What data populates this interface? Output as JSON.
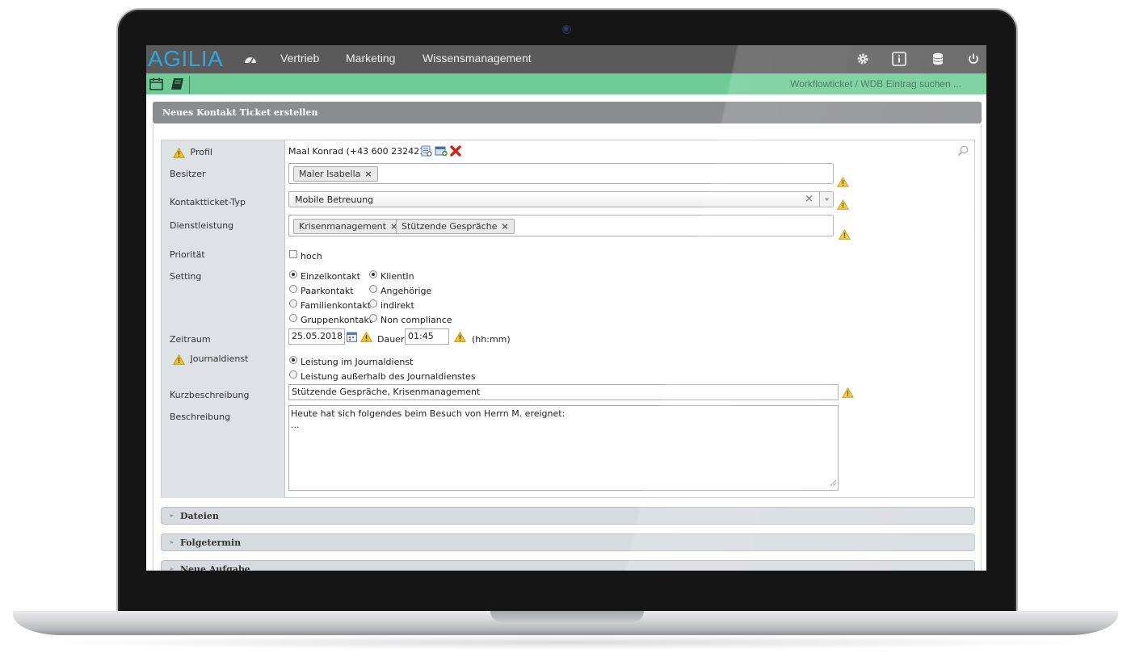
{
  "app": {
    "logo": "AGILIA"
  },
  "nav": {
    "menu": [
      "Vertrieb",
      "Marketing",
      "Wissensmanagement"
    ],
    "icons": [
      "dashboard-icon",
      "gear-icon",
      "info-icon",
      "database-icon",
      "power-icon"
    ]
  },
  "subbar": {
    "search_link": "Workflowticket / WDB Eintrag suchen ..."
  },
  "panel": {
    "title": "Neues Kontakt Ticket erstellen"
  },
  "form": {
    "labels": {
      "profil": "Profil",
      "besitzer": "Besitzer",
      "typ": "Kontaktticket-Typ",
      "dienstleistung": "Dienstleistung",
      "prioritaet": "Priorität",
      "setting": "Setting",
      "zeitraum": "Zeitraum",
      "journaldienst": "Journaldienst",
      "kurzbeschreibung": "Kurzbeschreibung",
      "beschreibung": "Beschreibung"
    },
    "profil_value": "Maal Konrad (+43 600 232421)",
    "besitzer_tags": [
      "Maler Isabella"
    ],
    "typ_value": "Mobile Betreuung",
    "dienstleistung_tags": [
      "Krisenmanagement",
      "Stützende Gespräche"
    ],
    "prioritaet": {
      "label": "hoch",
      "checked": false
    },
    "setting": {
      "left": [
        {
          "label": "Einzelkontakt",
          "selected": true
        },
        {
          "label": "Paarkontakt",
          "selected": false
        },
        {
          "label": "Familienkontakt",
          "selected": false
        },
        {
          "label": "Gruppenkontakt",
          "selected": false
        }
      ],
      "right": [
        {
          "label": "KlientIn",
          "selected": true
        },
        {
          "label": "Angehörige",
          "selected": false
        },
        {
          "label": "indirekt",
          "selected": false
        },
        {
          "label": "Non compliance",
          "selected": false
        }
      ]
    },
    "zeitraum": {
      "date": "25.05.2018",
      "dauer_label": "Dauer",
      "dauer": "01:45",
      "unit": "(hh:mm)"
    },
    "journaldienst": [
      {
        "label": "Leistung im Journaldienst",
        "selected": true
      },
      {
        "label": "Leistung außerhalb des Journaldienstes",
        "selected": false
      }
    ],
    "kurzbeschreibung": "Stützende Gespräche, Krisenmanagement",
    "beschreibung": "Heute hat sich folgendes beim Besuch von Herrn M. ereignet:\n..."
  },
  "accordions": [
    "Dateien",
    "Folgetermin",
    "Neue Aufgabe"
  ],
  "colors": {
    "nav_bg": "#5a5a5a",
    "subbar_bg": "#6fcc96",
    "logo": "#29a8e0",
    "panel_header": "#8b8c8e",
    "warning": "#f2c200"
  }
}
